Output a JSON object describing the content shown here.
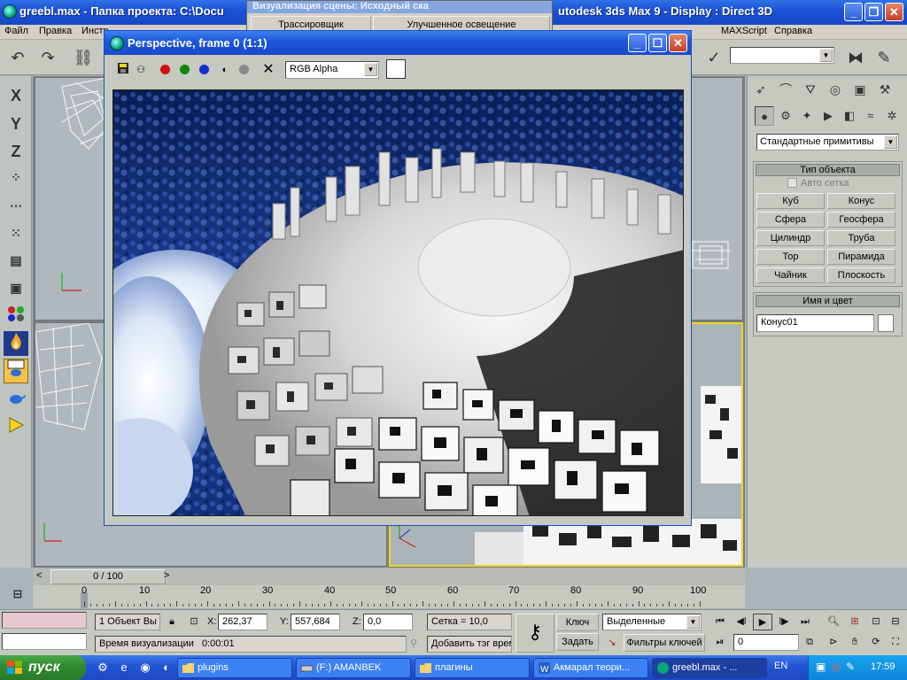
{
  "main_window": {
    "title": "greebl.max    - Папка проекта: C:\\Docu",
    "title_right": "utodesk 3ds Max 9      - Display : Direct 3D"
  },
  "menu": [
    "Файл",
    "Правка",
    "Инстр",
    "MAXScript",
    "Справка"
  ],
  "bg_dialog": {
    "title": "Визуализация сцены: Исходный ска",
    "tabs": [
      "Трассировщик",
      "Улучшенное освещение"
    ]
  },
  "render_window": {
    "title": "Perspective, frame 0 (1:1)",
    "channel": "RGB Alpha"
  },
  "left_toolbar": [
    "X",
    "Y",
    "Z"
  ],
  "command_panel": {
    "dropdown": "Стандартные примитивы",
    "object_type_title": "Тип объекта",
    "autogrid_label": "Авто сетка",
    "primitives": [
      "Куб",
      "Конус",
      "Сфера",
      "Геосфера",
      "Цилиндр",
      "Труба",
      "Тор",
      "Пирамида",
      "Чайник",
      "Плоскость"
    ],
    "name_color_title": "Имя и цвет",
    "object_name": "Конус01"
  },
  "time_slider": {
    "label": "0 / 100",
    "ticks": [
      "0",
      "10",
      "20",
      "30",
      "40",
      "50",
      "60",
      "70",
      "80",
      "90",
      "100"
    ]
  },
  "status": {
    "selection": "1 Объект Вы",
    "x_label": "X:",
    "x_value": "262,37",
    "y_label": "Y:",
    "y_value": "557,684",
    "z_label": "Z:",
    "z_value": "0,0",
    "grid": "Сетка = 10,0",
    "key_label": "Ключ",
    "set_label": "Задать",
    "selected_dropdown": "Выделенные",
    "key_filters": "Фильтры ключей",
    "frame_value": "0",
    "render_time_label": "Время визуализации",
    "render_time_value": "0:00:01",
    "add_tag": "Добавить тэг врем"
  },
  "taskbar": {
    "start": "пуск",
    "tasks": [
      "plugins",
      "(F:) AMANBEK",
      "плагины",
      "Акмарал теори...",
      "greebl.max    - ..."
    ],
    "language": "EN",
    "clock": "17:59"
  },
  "colors": {
    "xp_blue": "#2456d4",
    "start_green": "#2f8a2f",
    "active_viewport": "#f2d51b"
  }
}
